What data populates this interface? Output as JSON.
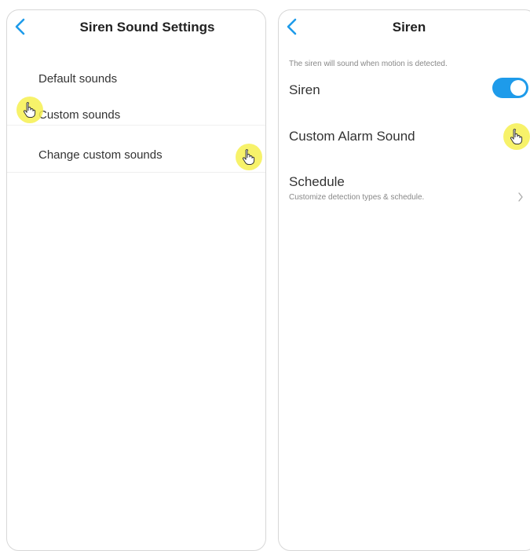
{
  "colors": {
    "accent": "#1e9bea",
    "tap_highlight": "#f6f050"
  },
  "left_screen": {
    "header": {
      "back_icon": "chevron-left-icon",
      "title": "Siren Sound Settings"
    },
    "options": [
      {
        "label": "Default sounds"
      },
      {
        "label": "Custom sounds"
      }
    ],
    "change_custom": {
      "label": "Change custom sounds"
    }
  },
  "right_screen": {
    "header": {
      "back_icon": "chevron-left-icon",
      "title": "Siren"
    },
    "hint": "The siren will sound when motion is detected.",
    "siren_toggle": {
      "label": "Siren",
      "on": true
    },
    "custom_alarm": {
      "label": "Custom Alarm Sound"
    },
    "schedule": {
      "label": "Schedule",
      "sublabel": "Customize detection types & schedule.",
      "icon": "chevron-right-icon"
    }
  },
  "tap_indicators": [
    "pointer-hand-icon",
    "pointer-hand-icon",
    "pointer-hand-icon"
  ]
}
